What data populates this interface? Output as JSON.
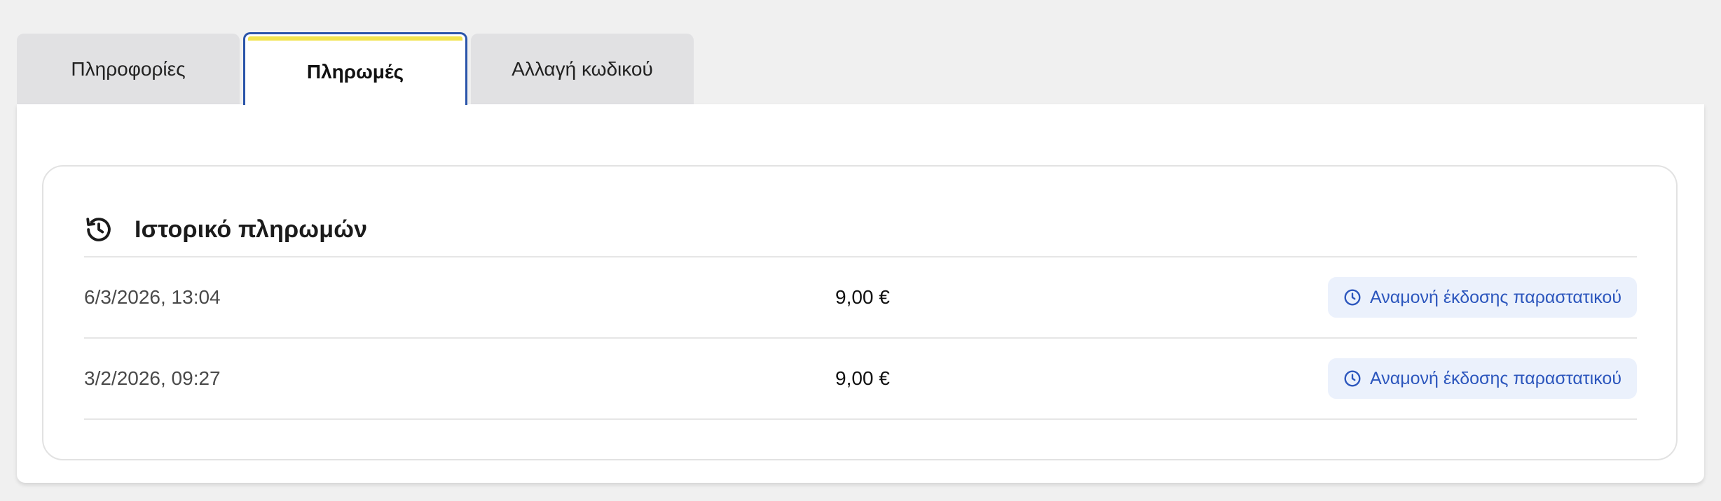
{
  "tabs": [
    {
      "label": "Πληροφορίες",
      "active": false
    },
    {
      "label": "Πληρωμές",
      "active": true
    },
    {
      "label": "Αλλαγή κωδικού",
      "active": false
    }
  ],
  "card": {
    "title": "Ιστορικό πληρωμών",
    "icon": "history-icon"
  },
  "payments": [
    {
      "date": "6/3/2026, 13:04",
      "amount": "9,00 €",
      "status": "Αναμονή έκδοσης παραστατικού",
      "status_icon": "clock-icon"
    },
    {
      "date": "3/2/2026, 09:27",
      "amount": "9,00 €",
      "status": "Αναμονή έκδοσης παραστατικού",
      "status_icon": "clock-icon"
    }
  ],
  "colors": {
    "accent_blue": "#2a54a9",
    "active_tab_stripe": "#f1e34e",
    "badge_bg": "#ebf1fc",
    "badge_text": "#2c56bd"
  }
}
